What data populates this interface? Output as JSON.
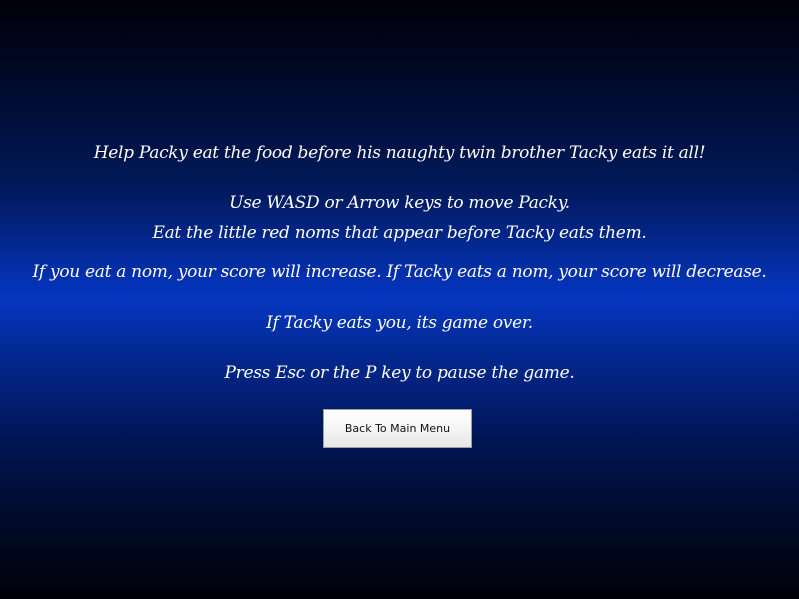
{
  "instructions": {
    "intro": "Help Packy eat the food before his naughty twin brother Tacky eats it all!",
    "controls": "Use WASD or Arrow keys to move Packy.",
    "goal": "Eat the little red noms that appear before Tacky eats them.",
    "scoring": "If you eat a nom, your score will increase. If Tacky eats a nom, your score will decrease.",
    "game_over": "If Tacky eats you, its game over.",
    "pause": "Press Esc or the P key to pause the game."
  },
  "buttons": {
    "back_label": "Back To Main Menu"
  },
  "colors": {
    "background_center": "#0536c0",
    "background_edge": "#000208",
    "text": "#ffffff",
    "button_face": "#f4f4f4"
  }
}
